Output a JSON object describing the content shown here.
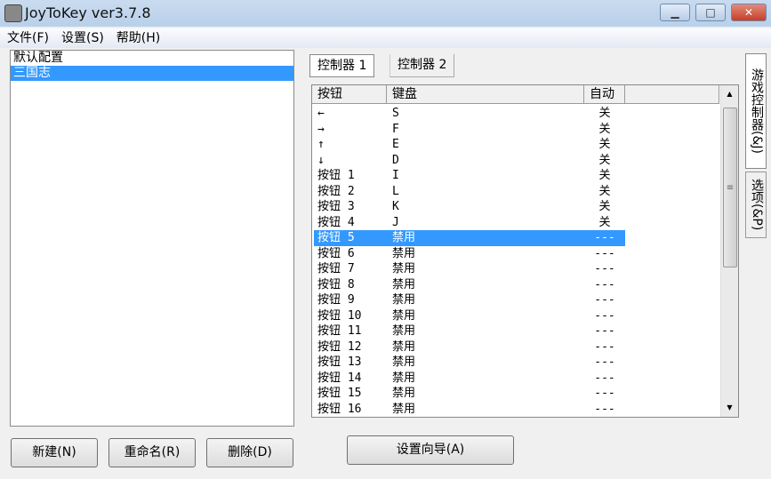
{
  "window": {
    "title": "JoyToKey ver3.7.8",
    "minimize": "▁",
    "maximize": "□",
    "close": "✕"
  },
  "menu": [
    "文件(F)",
    "设置(S)",
    "帮助(H)"
  ],
  "profiles": [
    {
      "label": "默认配置",
      "selected": false
    },
    {
      "label": "三国志",
      "selected": true
    }
  ],
  "left_buttons": {
    "new": "新建(N)",
    "rename": "重命名(R)",
    "delete": "删除(D)"
  },
  "tabs": [
    "控制器 1",
    "控制器 2"
  ],
  "columns": [
    "按钮",
    "键盘",
    "自动"
  ],
  "rows": [
    [
      "←",
      "S",
      "关"
    ],
    [
      "→",
      "F",
      "关"
    ],
    [
      "↑",
      "E",
      "关"
    ],
    [
      "↓",
      "D",
      "关"
    ],
    [
      "按钮 1",
      "I",
      "关"
    ],
    [
      "按钮 2",
      "L",
      "关"
    ],
    [
      "按钮 3",
      "K",
      "关"
    ],
    [
      "按钮 4",
      "J",
      "关"
    ],
    [
      "按钮 5",
      "禁用",
      "---"
    ],
    [
      "按钮 6",
      "禁用",
      "---"
    ],
    [
      "按钮 7",
      "禁用",
      "---"
    ],
    [
      "按钮 8",
      "禁用",
      "---"
    ],
    [
      "按钮 9",
      "禁用",
      "---"
    ],
    [
      "按钮 10",
      "禁用",
      "---"
    ],
    [
      "按钮 11",
      "禁用",
      "---"
    ],
    [
      "按钮 12",
      "禁用",
      "---"
    ],
    [
      "按钮 13",
      "禁用",
      "---"
    ],
    [
      "按钮 14",
      "禁用",
      "---"
    ],
    [
      "按钮 15",
      "禁用",
      "---"
    ],
    [
      "按钮 16",
      "禁用",
      "---"
    ]
  ],
  "selected_row": 8,
  "wizard_button": "设置向导(A)",
  "side_tabs": [
    "游戏控制器(&J)",
    "选项(&P)"
  ],
  "scroll": {
    "up": "▲",
    "down": "▼",
    "grip": "≡"
  }
}
